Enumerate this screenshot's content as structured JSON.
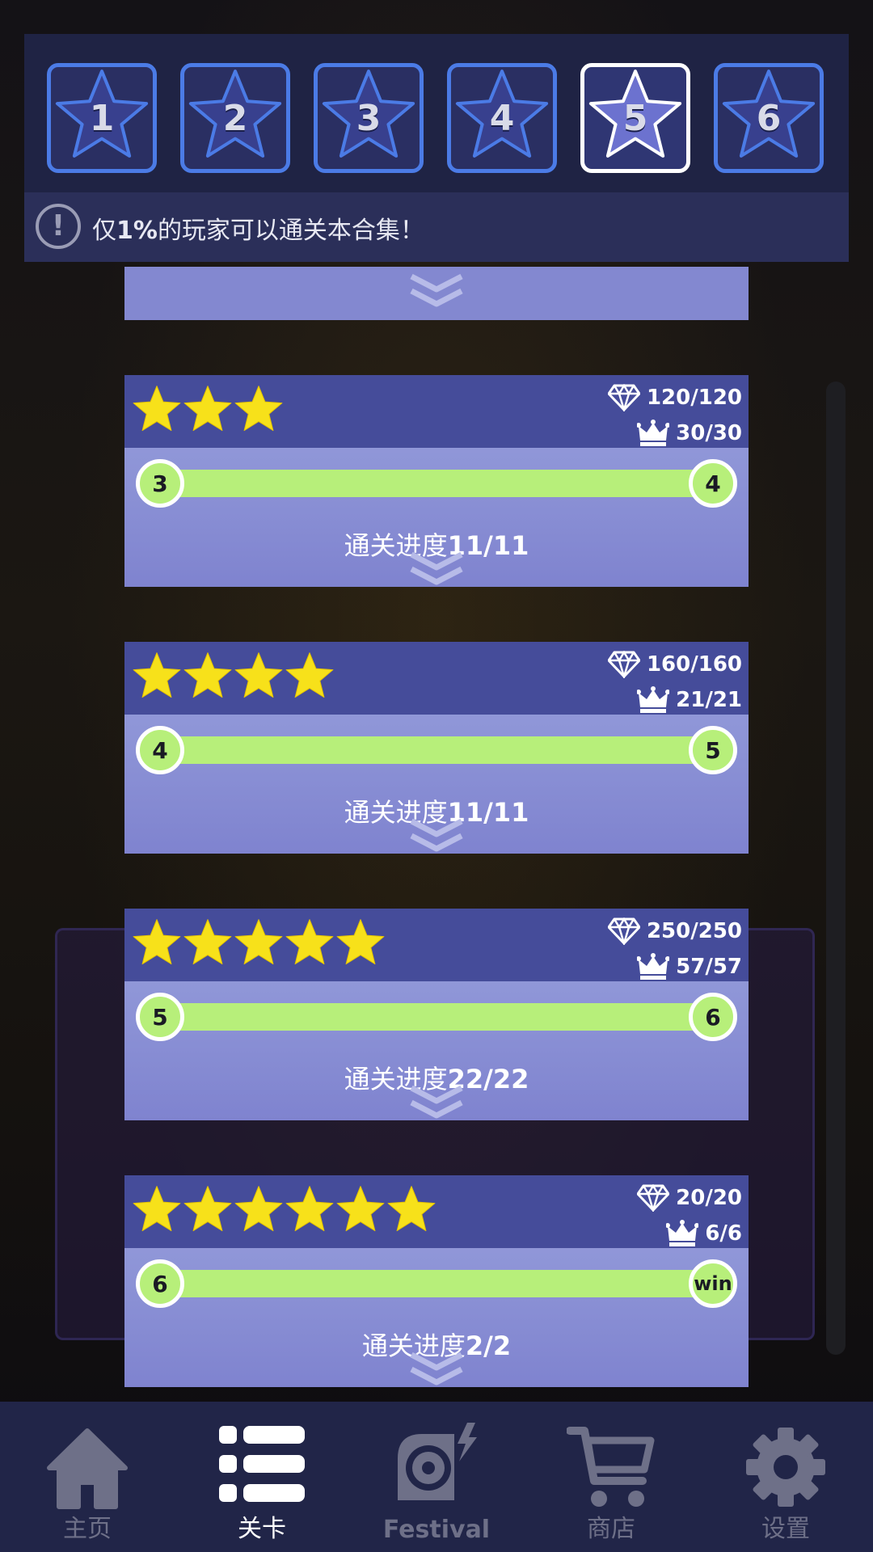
{
  "tiers": [
    {
      "label": "1",
      "active": false
    },
    {
      "label": "2",
      "active": false
    },
    {
      "label": "3",
      "active": false
    },
    {
      "label": "4",
      "active": false
    },
    {
      "label": "5",
      "active": true
    },
    {
      "label": "6",
      "active": false
    }
  ],
  "notice": {
    "icon": "exclamation-icon",
    "text_pre": "仅",
    "text_bold": "1%",
    "text_post": "的玩家可以通关本合集！"
  },
  "cards": [
    {
      "stars": 3,
      "gems": "120/120",
      "crowns": "30/30",
      "from": "3",
      "to": "4",
      "progress_label": "通关进度",
      "progress_value": "11/11",
      "fill": 1.0
    },
    {
      "stars": 4,
      "gems": "160/160",
      "crowns": "21/21",
      "from": "4",
      "to": "5",
      "progress_label": "通关进度",
      "progress_value": "11/11",
      "fill": 1.0
    },
    {
      "stars": 5,
      "gems": "250/250",
      "crowns": "57/57",
      "from": "5",
      "to": "6",
      "progress_label": "通关进度",
      "progress_value": "22/22",
      "fill": 1.0,
      "highlighted": true
    },
    {
      "stars": 6,
      "gems": "20/20",
      "crowns": "6/6",
      "from": "6",
      "to": "win",
      "progress_label": "通关进度",
      "progress_value": "2/2",
      "fill": 1.0
    }
  ],
  "nav": [
    {
      "label": "主页",
      "icon": "home-icon",
      "active": false
    },
    {
      "label": "关卡",
      "icon": "list-icon",
      "active": true
    },
    {
      "label": "Festival",
      "icon": "festival-disc-icon",
      "active": false
    },
    {
      "label": "商店",
      "icon": "cart-icon",
      "active": false
    },
    {
      "label": "设置",
      "icon": "gear-icon",
      "active": false
    }
  ],
  "colors": {
    "card_header": "#454c9a",
    "card_body": "#8a8fd4",
    "progress_green": "#b7ef7a",
    "star_yellow": "#f7e11a",
    "tier_border": "#4b7be6",
    "nav_bg": "#212548"
  }
}
